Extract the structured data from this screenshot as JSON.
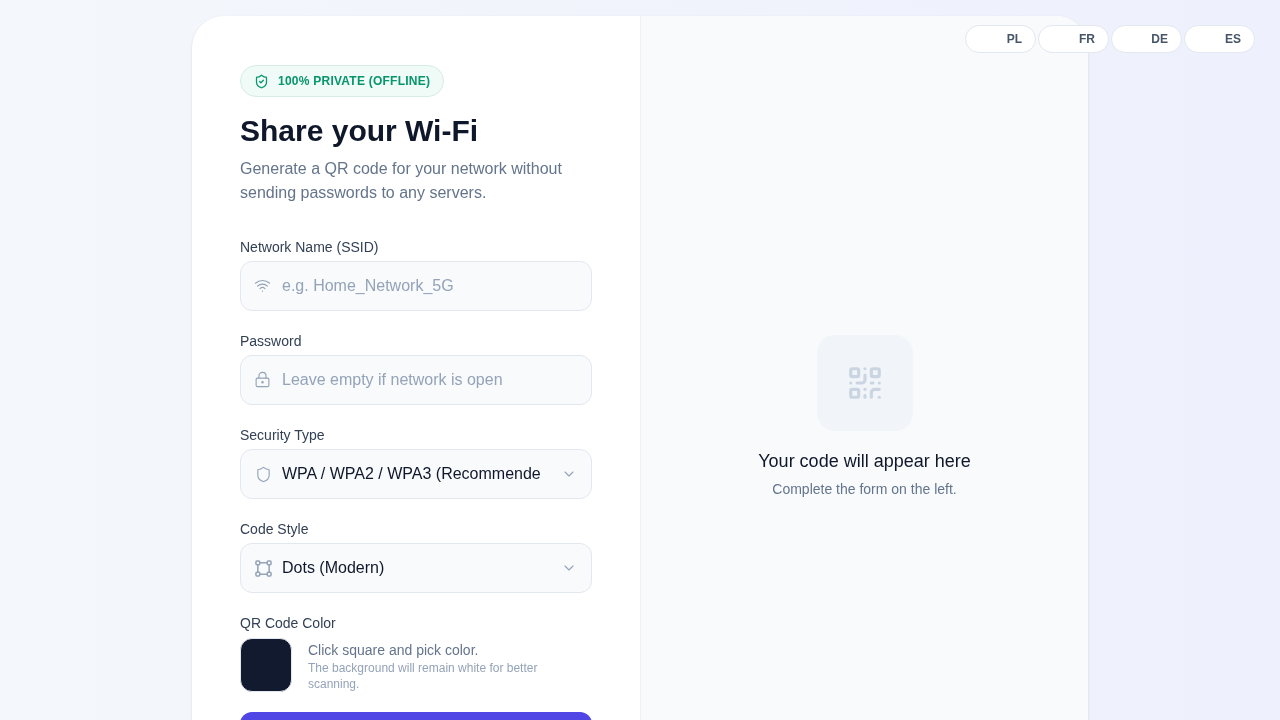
{
  "languages": [
    "PL",
    "FR",
    "DE",
    "ES"
  ],
  "form": {
    "badge": "100% PRIVATE (OFFLINE)",
    "title": "Share your Wi-Fi",
    "subtitle": "Generate a QR code for your network without sending passwords to any servers.",
    "fields": [
      {
        "kind": "text",
        "label": "Network Name (SSID)",
        "placeholder": "e.g. Home_Network_5G"
      },
      {
        "kind": "password",
        "label": "Password",
        "placeholder": "Leave empty if network is open"
      },
      {
        "kind": "select",
        "label": "Security Type",
        "value": "WPA / WPA2 / WPA3 (Recommende"
      },
      {
        "kind": "select",
        "label": "Code Style",
        "value": "Dots (Modern)"
      },
      {
        "kind": "color",
        "label": "QR Code Color",
        "color": "#111a2e",
        "hint": "Click square and pick color.",
        "note": "The background will remain white for better scanning."
      }
    ]
  },
  "preview": {
    "title": "Your code will appear here",
    "subtitle": "Complete the form on the left."
  }
}
